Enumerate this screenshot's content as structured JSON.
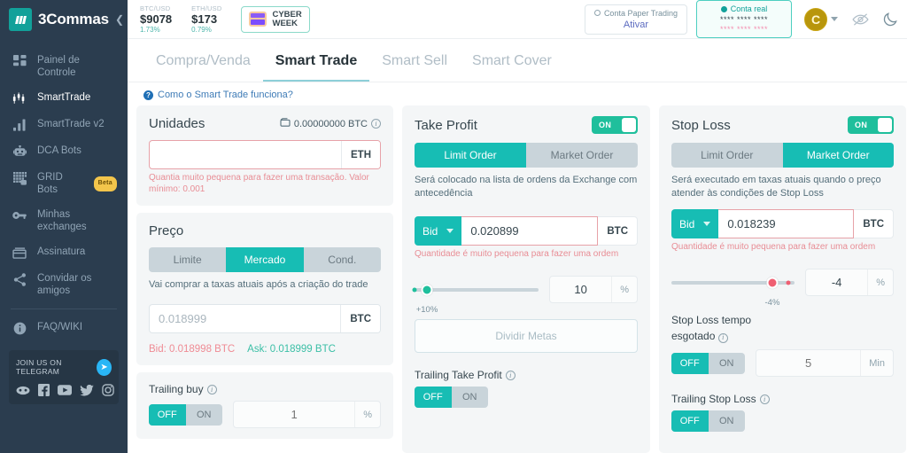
{
  "brand": {
    "name": "3Commas",
    "logo_icon": "three-bars-logo",
    "collapse_icon": "chevron-left-icon"
  },
  "sidebar": {
    "items": [
      {
        "label": "Painel de Controle",
        "icon": "dashboard-icon",
        "active": false
      },
      {
        "label": "SmartTrade",
        "icon": "candlestick-icon",
        "active": true
      },
      {
        "label": "SmartTrade v2",
        "icon": "bar-chart-icon",
        "active": false
      },
      {
        "label": "DCA Bots",
        "icon": "robot-icon",
        "active": false
      },
      {
        "label": "GRID Bots",
        "icon": "grid-icon",
        "active": false,
        "badge": "Beta"
      },
      {
        "label": "Minhas exchanges",
        "icon": "key-icon",
        "active": false
      },
      {
        "label": "Assinatura",
        "icon": "card-icon",
        "active": false
      },
      {
        "label": "Convidar os amigos",
        "icon": "share-icon",
        "active": false
      },
      {
        "label": "FAQ/WIKI",
        "icon": "info-icon",
        "active": false
      }
    ],
    "telegram": {
      "text": "JOIN US ON TELEGRAM",
      "button_icon": "telegram-icon",
      "socials": [
        "discord-icon",
        "facebook-icon",
        "youtube-icon",
        "twitter-icon",
        "instagram-icon"
      ]
    }
  },
  "topbar": {
    "tickers": [
      {
        "label": "BTC/USD",
        "price": "$9078",
        "change": "1.73%"
      },
      {
        "label": "ETH/USD",
        "price": "$173",
        "change": "0.79%"
      }
    ],
    "promo": {
      "line1": "CYBER",
      "line2": "WEEK",
      "icon": "gift-icon"
    },
    "paper_account": {
      "label": "Conta Paper Trading",
      "action": "Ativar",
      "radio_icon": "radio-unchecked-icon"
    },
    "real_account": {
      "label": "Conta real",
      "mask_top": "**** **** ****",
      "mask_bottom": "**** **** ****",
      "radio_icon": "radio-checked-icon"
    },
    "avatar": {
      "initial": "C",
      "caret_icon": "chevron-down-icon"
    },
    "eye_icon": "eye-off-icon",
    "theme_icon": "moon-icon"
  },
  "tabs": [
    {
      "label": "Compra/Venda",
      "active": false
    },
    {
      "label": "Smart Trade",
      "active": true
    },
    {
      "label": "Smart Sell",
      "active": false
    },
    {
      "label": "Smart Cover",
      "active": false
    }
  ],
  "howto": {
    "icon": "question-mark-icon",
    "text": "Como o Smart Trade funciona?"
  },
  "units_card": {
    "title": "Unidades",
    "wallet_icon": "wallet-icon",
    "balance": "0.00000000 BTC",
    "info_icon": "info-circle-icon",
    "input_value": "",
    "input_placeholder": "",
    "unit": "ETH",
    "error": "Quantia muito pequena para fazer uma transação. Valor mínimo: 0.001"
  },
  "price_card": {
    "title": "Preço",
    "modes": [
      {
        "label": "Limite",
        "active": false
      },
      {
        "label": "Mercado",
        "active": true
      },
      {
        "label": "Cond.",
        "active": false
      }
    ],
    "hint": "Vai comprar a taxas atuais após a criação do trade",
    "price_placeholder": "0.018999",
    "price_value": "",
    "unit": "BTC",
    "bid": "Bid: 0.018998 BTC",
    "ask": "Ask: 0.018999 BTC",
    "trailing": {
      "label": "Trailing buy",
      "info_icon": "info-circle-icon",
      "off_label": "OFF",
      "on_label": "ON",
      "state": "OFF",
      "value": "1",
      "suffix": "%"
    }
  },
  "take_profit": {
    "title": "Take Profit",
    "toggle_label": "ON",
    "toggle_state": "ON",
    "order_types": [
      {
        "label": "Limit Order",
        "active": true
      },
      {
        "label": "Market Order",
        "active": false
      }
    ],
    "hint": "Será colocado na lista de ordens da Exchange com antecedência",
    "source": "Bid",
    "source_caret_icon": "chevron-down-icon",
    "value": "0.020899",
    "unit": "BTC",
    "error": "Quantidade é muito pequena para fazer uma ordem",
    "slider": {
      "caption": "+10%",
      "percent_position": 10,
      "color": "#1fbf9c"
    },
    "percent_value": "10",
    "percent_suffix": "%",
    "split_button": "Dividir Metas",
    "trailing": {
      "label": "Trailing Take Profit",
      "info_icon": "info-circle-icon",
      "off_label": "OFF",
      "on_label": "ON",
      "state": "OFF"
    }
  },
  "stop_loss": {
    "title": "Stop Loss",
    "toggle_label": "ON",
    "toggle_state": "ON",
    "order_types": [
      {
        "label": "Limit Order",
        "active": false
      },
      {
        "label": "Market Order",
        "active": true
      }
    ],
    "hint": "Será executado em taxas atuais quando o preço atender às condições de Stop Loss",
    "source": "Bid",
    "source_caret_icon": "chevron-down-icon",
    "value": "0.018239",
    "unit": "BTC",
    "error": "Quantidade é muito pequena para fazer uma ordem",
    "slider": {
      "caption": "-4%",
      "percent_position": 82,
      "color": "#ef5f72"
    },
    "percent_value": "-4",
    "percent_suffix": "%",
    "timeout": {
      "label_line1": "Stop Loss tempo",
      "label_line2": "esgotado",
      "info_icon": "info-circle-icon",
      "off_label": "OFF",
      "on_label": "ON",
      "state": "OFF",
      "value": "5",
      "suffix": "Min"
    },
    "trailing": {
      "label": "Trailing Stop Loss",
      "info_icon": "info-circle-icon",
      "off_label": "OFF",
      "on_label": "ON",
      "state": "OFF"
    }
  },
  "colors": {
    "brand_teal": "#12a19a",
    "accent_teal": "#17bdb4",
    "sidebar_bg": "#2b3d4f",
    "error_red": "#e88d95",
    "slider_red": "#ef5f72",
    "card_bg": "#f4f6f7"
  }
}
